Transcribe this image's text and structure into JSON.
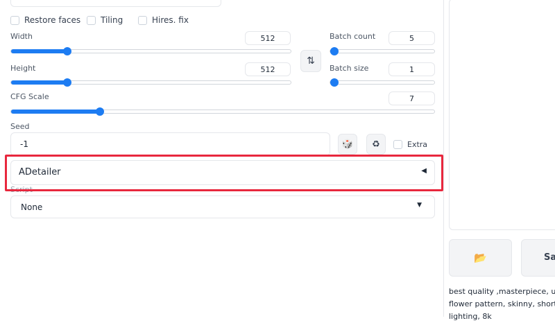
{
  "checkboxes": {
    "restore_faces": "Restore faces",
    "tiling": "Tiling",
    "hires_fix": "Hires. fix"
  },
  "width": {
    "label": "Width",
    "value": "512",
    "fraction": 0.2
  },
  "height": {
    "label": "Height",
    "value": "512",
    "fraction": 0.2
  },
  "batch_count": {
    "label": "Batch count",
    "value": "5",
    "fraction": 0.03
  },
  "batch_size": {
    "label": "Batch size",
    "value": "1",
    "fraction": 0.0
  },
  "cfg_scale": {
    "label": "CFG Scale",
    "value": "7",
    "fraction": 0.21
  },
  "swap_icon": "⇅",
  "seed": {
    "label": "Seed",
    "value": "-1",
    "dice_icon": "🎲",
    "recycle_icon": "♻",
    "extra_label": "Extra"
  },
  "adetailer": {
    "title": "ADetailer",
    "arrow": "◀"
  },
  "script": {
    "label": "Script",
    "value": "None",
    "caret": "▼"
  },
  "output": {
    "folder_icon": "📂",
    "save_label": "Sav",
    "prompt_lines": [
      "best quality ,masterpiece, ultra h",
      "flower pattern, skinny, short hair,",
      "lighting, 8k"
    ]
  },
  "colors": {
    "accent": "#1d7cf2",
    "highlight_outline": "#e8273d"
  }
}
